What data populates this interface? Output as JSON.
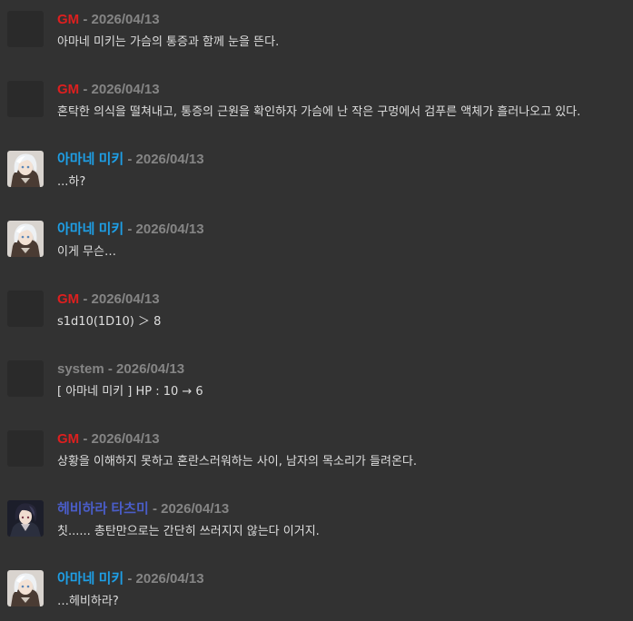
{
  "colors": {
    "background": "#323232",
    "gm": "#dd1f1f",
    "mikki": "#1e9fe6",
    "system": "#858585",
    "tatsumi": "#4a5dc8",
    "timestamp": "#858585",
    "text": "#dedede"
  },
  "separator": " - ",
  "messages": [
    {
      "speaker": "GM",
      "time": "2026/04/13",
      "text": "아마네 미키는 가슴의 통증과 함께 눈을 뜬다.",
      "avatar": "blank"
    },
    {
      "speaker": "GM",
      "time": "2026/04/13",
      "text": "혼탁한 의식을 떨쳐내고, 통증의 근원을 확인하자 가슴에 난 작은 구멍에서 검푸른 액체가 흘러나오고 있다.",
      "avatar": "blank"
    },
    {
      "speaker": "아마네 미키",
      "time": "2026/04/13",
      "text": "...하?",
      "avatar": "white-haired-girl"
    },
    {
      "speaker": "아마네 미키",
      "time": "2026/04/13",
      "text": "이게 무슨…",
      "avatar": "white-haired-girl"
    },
    {
      "speaker": "GM",
      "time": "2026/04/13",
      "text": "s1d10(1D10) ＞ 8",
      "avatar": "blank"
    },
    {
      "speaker": "system",
      "time": "2026/04/13",
      "text": "[ 아마네 미키 ] HP : 10 → 6",
      "avatar": "blank"
    },
    {
      "speaker": "GM",
      "time": "2026/04/13",
      "text": "상황을 이해하지 못하고 혼란스러워하는 사이, 남자의 목소리가 들려온다.",
      "avatar": "blank"
    },
    {
      "speaker": "헤비하라 타츠미",
      "time": "2026/04/13",
      "text": "칫...... 총탄만으로는 간단히 쓰러지지 않는다 이거지.",
      "avatar": "dark-haired-man"
    },
    {
      "speaker": "아마네 미키",
      "time": "2026/04/13",
      "text": "…헤비하라?",
      "avatar": "white-haired-girl"
    }
  ]
}
